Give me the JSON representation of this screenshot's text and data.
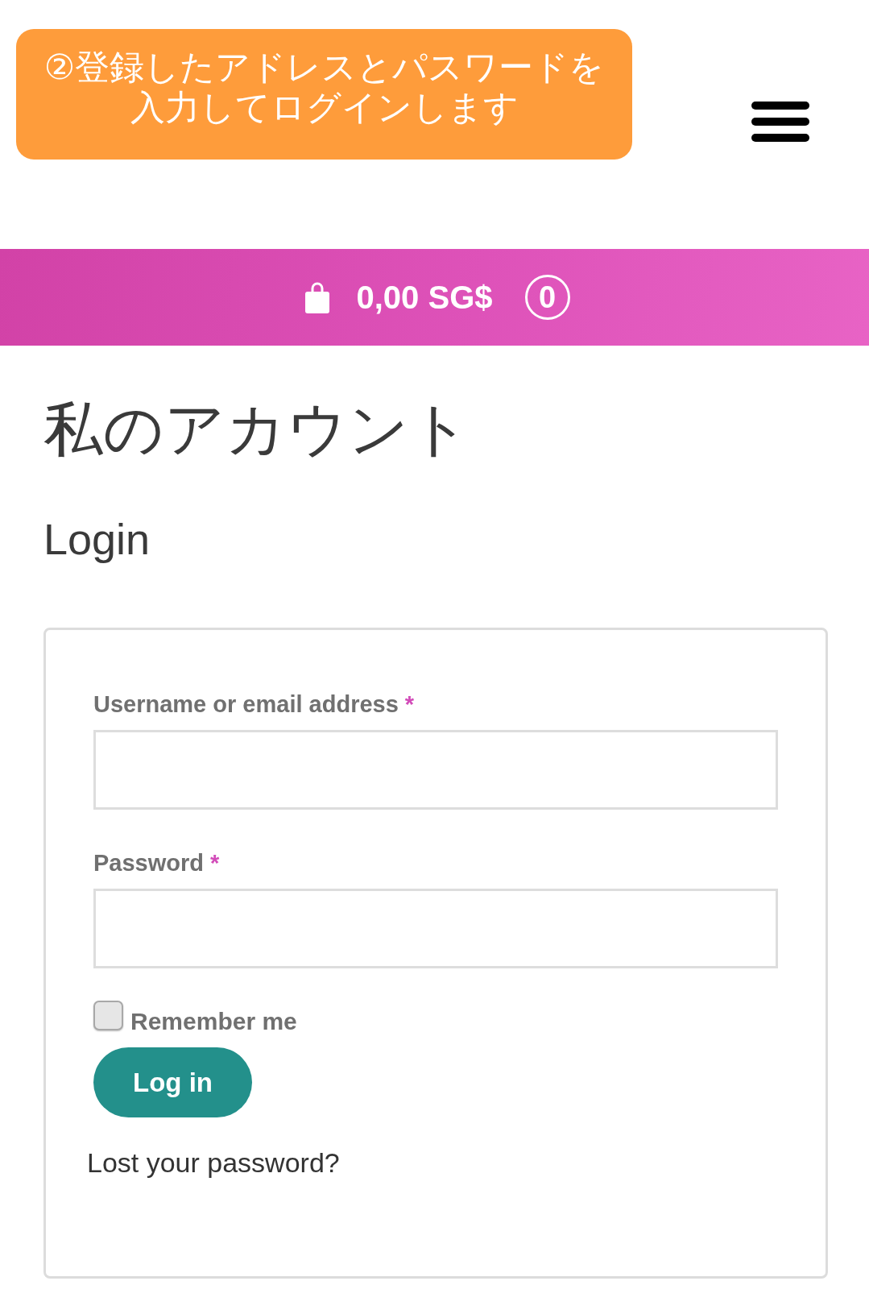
{
  "callout": {
    "text": "②登録したアドレスとパスワードを入力してログインします"
  },
  "cart_bar": {
    "total": "0,00 SG$",
    "count": "0"
  },
  "page_title": "私のアカウント",
  "section_title": "Login",
  "login_form": {
    "fields": [
      {
        "label": "Username or email address",
        "required_mark": "*"
      },
      {
        "label": "Password",
        "required_mark": "*"
      }
    ],
    "remember": {
      "label": "Remember me",
      "checked": false
    },
    "submit": {
      "label": "Log in"
    },
    "lost_password": {
      "label": "Lost your password?"
    }
  }
}
